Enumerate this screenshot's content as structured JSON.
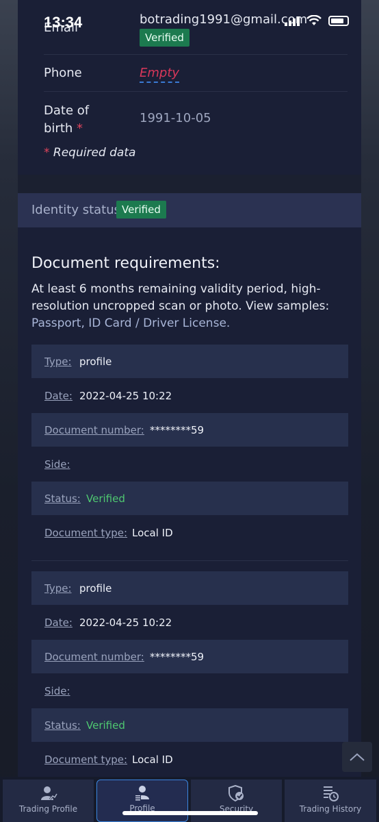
{
  "status_bar": {
    "time": "13:34"
  },
  "account": {
    "email_label": "Email",
    "email_value": "botrading1991@gmail.com",
    "email_badge": "Verified",
    "phone_label": "Phone",
    "phone_value": "Empty",
    "dob_label": "Date of birth",
    "dob_value": "1991-10-05",
    "required_note": "Required data"
  },
  "identity": {
    "title": "Identity status",
    "badge": "Verified"
  },
  "documents": {
    "title": "Document requirements:",
    "description": "At least 6 months remaining validity period, high-resolution uncropped scan or photo. View samples:",
    "link_passport": "Passport",
    "link_id": "ID Card / Driver License",
    "records": [
      {
        "type_label": "Type:",
        "type_value": "profile",
        "date_label": "Date:",
        "date_value": "2022-04-25 10:22",
        "number_label": "Document number:",
        "number_value": "********59",
        "side_label": "Side:",
        "status_label": "Status:",
        "status_value": "Verified",
        "doctype_label": "Document type:",
        "doctype_value": "Local ID"
      },
      {
        "type_label": "Type:",
        "type_value": "profile",
        "date_label": "Date:",
        "date_value": "2022-04-25 10:22",
        "number_label": "Document number:",
        "number_value": "********59",
        "side_label": "Side:",
        "status_label": "Status:",
        "status_value": "Verified",
        "doctype_label": "Document type:",
        "doctype_value": "Local ID"
      }
    ]
  },
  "tabs": [
    {
      "label": "Trading Profile",
      "icon": "trading-profile-icon"
    },
    {
      "label": "Profile",
      "icon": "profile-icon"
    },
    {
      "label": "Security",
      "icon": "shield-icon"
    },
    {
      "label": "Trading History",
      "icon": "trading-history-icon"
    }
  ],
  "colors": {
    "accent": "#3b86e0",
    "verified": "#1c7a4f",
    "status_green": "#4fc971",
    "empty": "#d8375a"
  }
}
